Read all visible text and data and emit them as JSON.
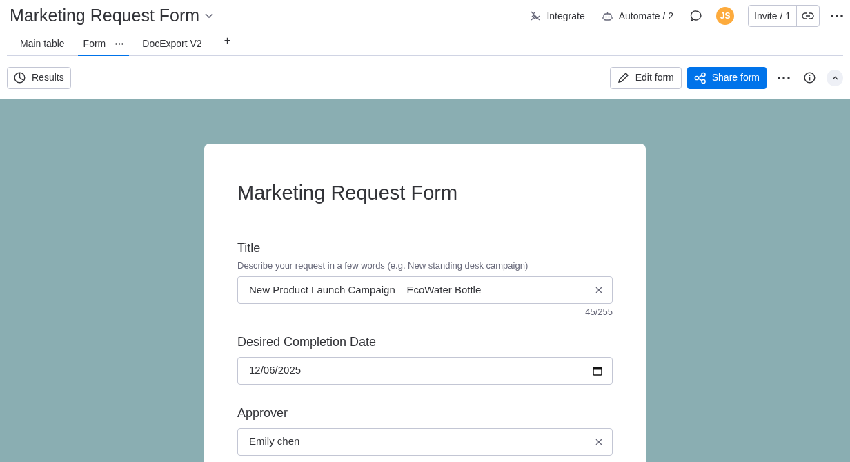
{
  "board": {
    "title": "Marketing Request Form"
  },
  "header_actions": [
    {
      "kind": "integrate",
      "label": "Integrate"
    },
    {
      "kind": "automate",
      "label": "Automate / 2"
    }
  ],
  "avatar": {
    "initials": "JS"
  },
  "invite": {
    "label": "Invite / 1"
  },
  "tabs": [
    {
      "label": "Main table",
      "selected": false,
      "menu": false
    },
    {
      "label": "Form",
      "selected": true,
      "menu": true
    },
    {
      "label": "DocExport V2",
      "selected": false,
      "menu": false
    }
  ],
  "add_tab": {
    "label": "+"
  },
  "toolbar": {
    "results": "Results",
    "edit": "Edit form",
    "share": "Share form"
  },
  "form": {
    "title": "Marketing Request Form",
    "fields": [
      {
        "kind": "text",
        "label": "Title",
        "description": "Describe your request in a few words (e.g. New standing desk campaign)",
        "value": "New Product Launch Campaign – EcoWater Bottle",
        "clearable": true,
        "counter": "45/255"
      },
      {
        "kind": "date",
        "label": "Desired Completion Date",
        "value": "12/06/2025",
        "clearable": false
      },
      {
        "kind": "text",
        "label": "Approver",
        "value": "Emily chen",
        "clearable": true
      }
    ]
  }
}
